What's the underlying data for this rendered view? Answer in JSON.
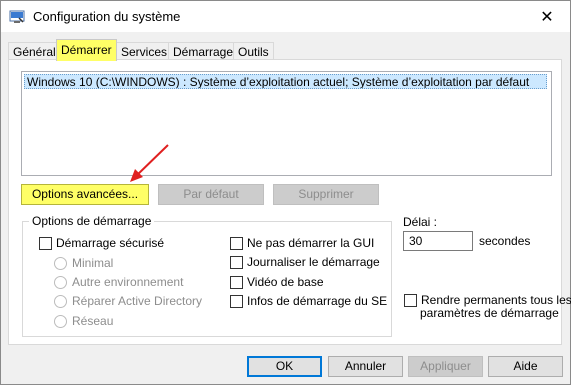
{
  "window": {
    "title": "Configuration du système",
    "close_glyph": "✕"
  },
  "tabs": [
    {
      "label": "Général"
    },
    {
      "label": "Démarrer"
    },
    {
      "label": "Services"
    },
    {
      "label": "Démarrage"
    },
    {
      "label": "Outils"
    }
  ],
  "boot_list": {
    "items": [
      "Windows 10 (C:\\WINDOWS) : Système d’exploitation actuel; Système d’exploitation par défaut"
    ]
  },
  "buttons": {
    "advanced": "Options avancées...",
    "default": "Par défaut",
    "delete": "Supprimer",
    "ok": "OK",
    "cancel": "Annuler",
    "apply": "Appliquer",
    "help": "Aide"
  },
  "boot_options": {
    "group_label": "Options de démarrage",
    "safe_boot": "Démarrage sécurisé",
    "radios": [
      "Minimal",
      "Autre environnement",
      "Réparer Active Directory",
      "Réseau"
    ],
    "no_gui": "Ne pas démarrer la GUI",
    "boot_log": "Journaliser le démarrage",
    "base_video": "Vidéo de base",
    "os_info": "Infos de démarrage du SE"
  },
  "timeout": {
    "label": "Délai :",
    "value": "30",
    "unit": "secondes"
  },
  "permanent": {
    "label_line1": "Rendre permanents tous les",
    "label_line2": "paramètres de démarrage"
  },
  "colors": {
    "highlight": "#ffff66",
    "arrow": "#e02020",
    "selection": "#cce8ff"
  }
}
